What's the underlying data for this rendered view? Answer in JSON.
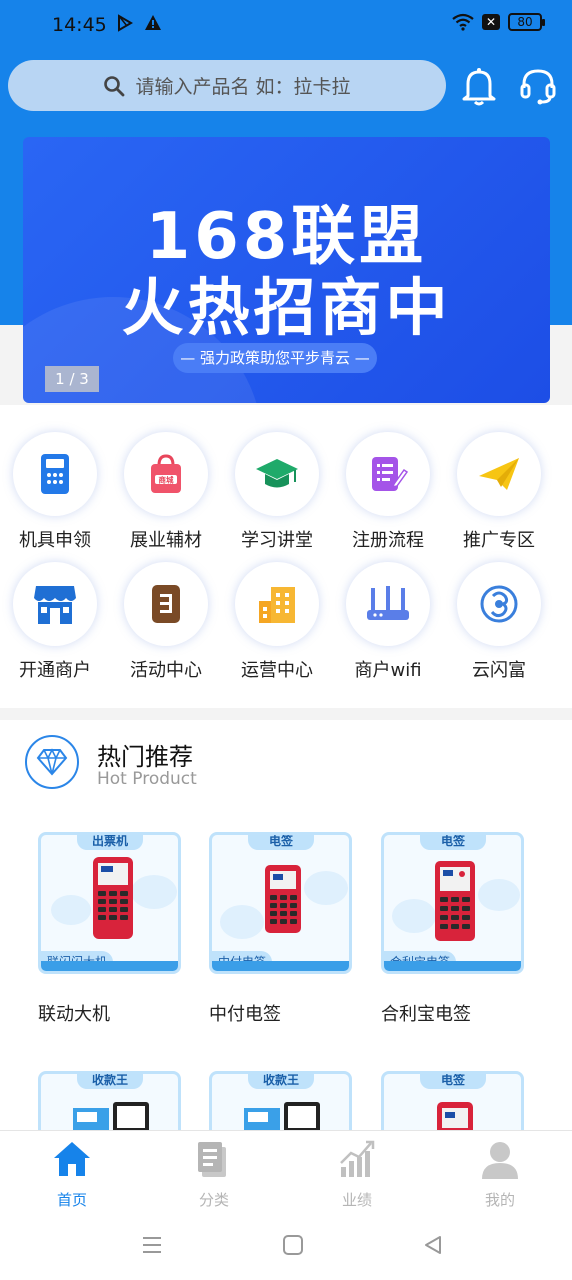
{
  "status_bar": {
    "time": "14:45",
    "battery": "80"
  },
  "search": {
    "placeholder": "请输入产品名  如：拉卡拉"
  },
  "banner": {
    "title_line1": "168联盟",
    "title_line2": "火热招商中",
    "subtitle": "— 强力政策助您平步青云 —",
    "indicator": "1 / 3"
  },
  "menu": [
    {
      "label": "机具申领",
      "icon": "pos-terminal-icon"
    },
    {
      "label": "展业辅材",
      "icon": "shopping-bag-icon"
    },
    {
      "label": "学习讲堂",
      "icon": "graduation-cap-icon"
    },
    {
      "label": "注册流程",
      "icon": "register-doc-icon"
    },
    {
      "label": "推广专区",
      "icon": "paper-plane-icon"
    },
    {
      "label": "开通商户",
      "icon": "storefront-icon"
    },
    {
      "label": "活动中心",
      "icon": "activity-doc-icon"
    },
    {
      "label": "运营中心",
      "icon": "building-icon"
    },
    {
      "label": "商户wifi",
      "icon": "router-icon"
    },
    {
      "label": "云闪富",
      "icon": "cloud-flash-icon"
    }
  ],
  "hot": {
    "title": "热门推荐",
    "subtitle": "Hot Product"
  },
  "products": [
    {
      "tag": "出票机",
      "badge": "联闪闪大机",
      "name": "联动大机"
    },
    {
      "tag": "电签",
      "badge": "中付电签",
      "name": "中付电签"
    },
    {
      "tag": "电签",
      "badge": "合利宝电签",
      "name": "合利宝电签"
    },
    {
      "tag": "收款王",
      "badge": "",
      "name": ""
    },
    {
      "tag": "收款王",
      "badge": "",
      "name": ""
    },
    {
      "tag": "电签",
      "badge": "",
      "name": ""
    }
  ],
  "tabs": [
    {
      "label": "首页",
      "icon": "home-icon",
      "active": true
    },
    {
      "label": "分类",
      "icon": "category-icon",
      "active": false
    },
    {
      "label": "业绩",
      "icon": "chart-icon",
      "active": false
    },
    {
      "label": "我的",
      "icon": "user-icon",
      "active": false
    }
  ],
  "colors": {
    "primary": "#1683ea",
    "banner": "#1d4ee6",
    "tab_active": "#1683ea",
    "tab_inactive": "#b5b5b5"
  }
}
